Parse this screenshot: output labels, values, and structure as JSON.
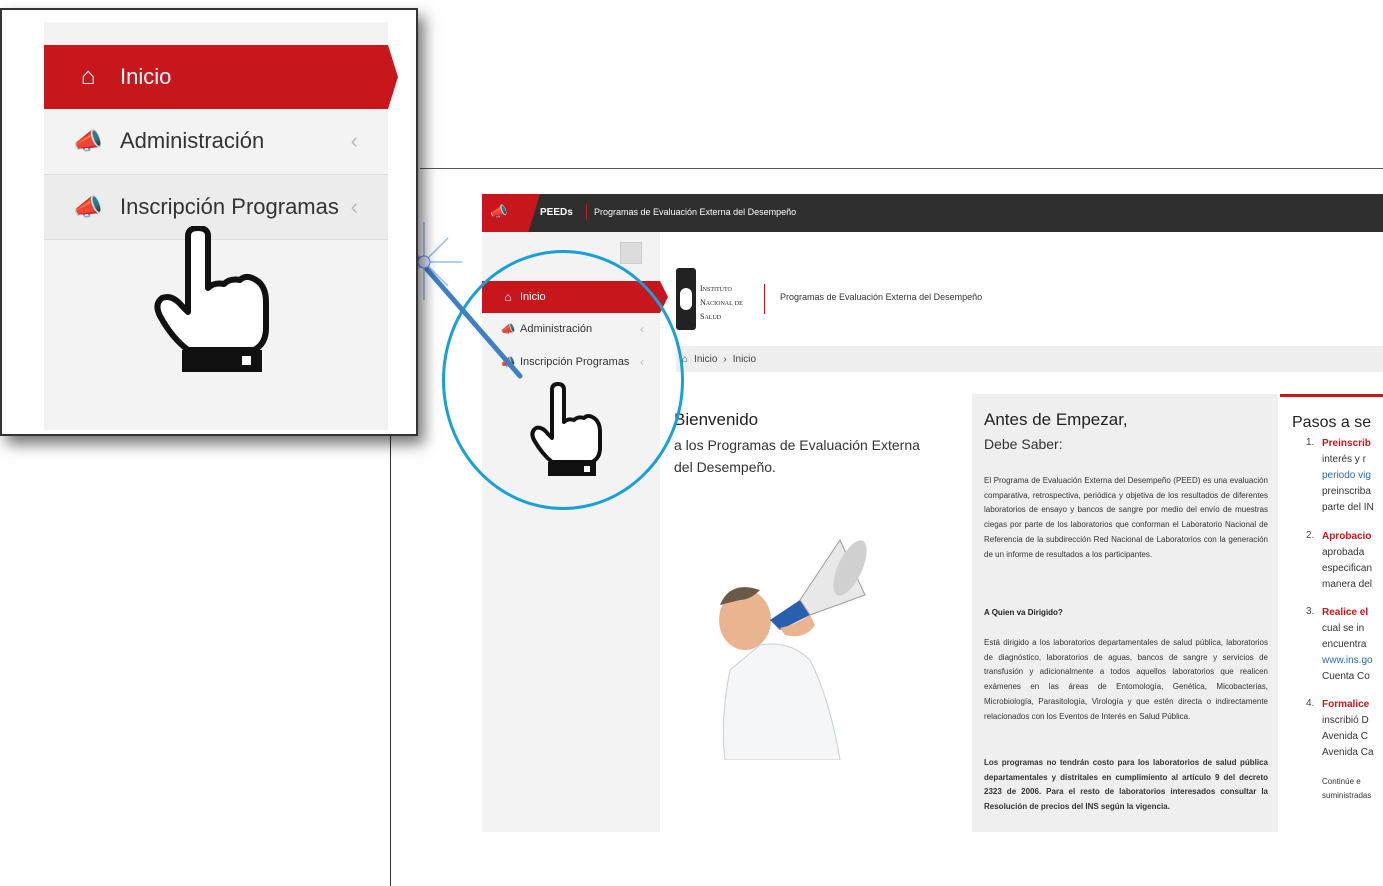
{
  "app": {
    "top_brand": "PEEDs",
    "top_subtitle": "Programas de Evaluación Externa del Desempeño"
  },
  "sidebar": {
    "items": [
      {
        "label": "Inicio",
        "icon": "home-icon",
        "active": true
      },
      {
        "label": "Administración",
        "icon": "megaphone-icon",
        "active": false
      },
      {
        "label": "Inscripción Programas",
        "icon": "megaphone-icon",
        "active": false
      }
    ]
  },
  "header": {
    "institute": [
      "Instituto",
      "Nacional de",
      "Salud"
    ],
    "program_title": "Programas de Evaluación Externa del Desempeño"
  },
  "breadcrumb": {
    "items": [
      "Inicio",
      "Inicio"
    ]
  },
  "welcome": {
    "title": "Bienvenido",
    "subtitle": "a los Programas de Evaluación Externa del Desempeño."
  },
  "info": {
    "title": "Antes de Empezar,",
    "subtitle": "Debe Saber:",
    "paragraph1": "El Programa de Evaluación Externa del Desempeño (PEED) es una evaluación comparativa, retrospectiva, periódica y objetiva de los resultados de diferentes laboratorios de ensayo y bancos de sangre por medio del envío de muestras ciegas por parte de los laboratorios que conforman el Laboratorio Nacional de Referencia de la subdirección Red Nacional de Laboratorios con la generación de un informe de resultados a los participantes.",
    "heading2": "A Quien va Dirigido?",
    "paragraph2": "Está dirigido a los laboratorios departamentales de salud pública, laboratorios de diagnóstico, laboratorios de aguas, bancos de sangre y servicios de transfusión y adicionalmente a todos aquellos laboratorios que realicen exámenes en las áreas de Entomología, Genética, Micobacterias, Microbiología, Parasitología, Virología y que estén directa o indirectamente relacionados con los Eventos de Interés en Salud Pública.",
    "paragraph3": "Los programas no tendrán costo para los laboratorios de salud pública departamentales y distritales en cumplimiento al artículo 9 del decreto 2323 de 2006. Para el resto de laboratorios interesados consultar la Resolución de precios del INS según la vigencia."
  },
  "steps": {
    "title": "Pasos a se",
    "items": [
      {
        "num": "1.",
        "lines": [
          "Preinscrib",
          "interés y r",
          "periodo vig",
          "preinscriba",
          "parte del IN"
        ]
      },
      {
        "num": "2.",
        "lines": [
          "Aprobacio",
          "aprobada",
          "especifican",
          "manera del"
        ]
      },
      {
        "num": "3.",
        "lines": [
          "Realice el",
          "cual se in",
          "encuentra",
          "www.ins.go",
          "Cuenta Co"
        ]
      },
      {
        "num": "4.",
        "lines": [
          "Formalice",
          "inscribió D",
          "Avenida C",
          "Avenida Ca"
        ]
      }
    ],
    "footer": [
      "Continúe e",
      "suministradas"
    ]
  },
  "colors": {
    "accent": "#c8161d",
    "topbar": "#2f2f2f",
    "highlight_circle": "#1a9fd6"
  }
}
